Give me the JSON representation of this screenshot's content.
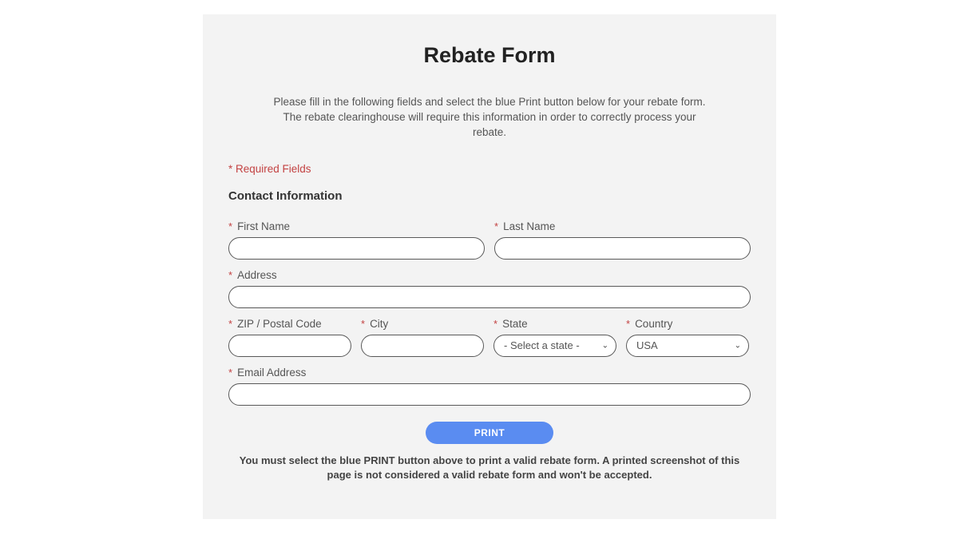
{
  "title": "Rebate Form",
  "intro": "Please fill in the following fields and select the blue Print button below for your rebate form. The rebate clearinghouse will require this information in order to correctly process your rebate.",
  "required_note": "* Required Fields",
  "section_heading": "Contact Information",
  "fields": {
    "first_name": {
      "label": "First Name",
      "value": ""
    },
    "last_name": {
      "label": "Last Name",
      "value": ""
    },
    "address": {
      "label": "Address",
      "value": ""
    },
    "zip": {
      "label": "ZIP / Postal Code",
      "value": ""
    },
    "city": {
      "label": "City",
      "value": ""
    },
    "state": {
      "label": "State",
      "selected": "- Select a state -"
    },
    "country": {
      "label": "Country",
      "selected": "USA"
    },
    "email": {
      "label": "Email Address",
      "value": ""
    }
  },
  "print_button": "PRINT",
  "disclaimer": "You must select the blue PRINT button above to print a valid rebate form. A printed screenshot of this page is not considered a valid rebate form and won't be accepted."
}
